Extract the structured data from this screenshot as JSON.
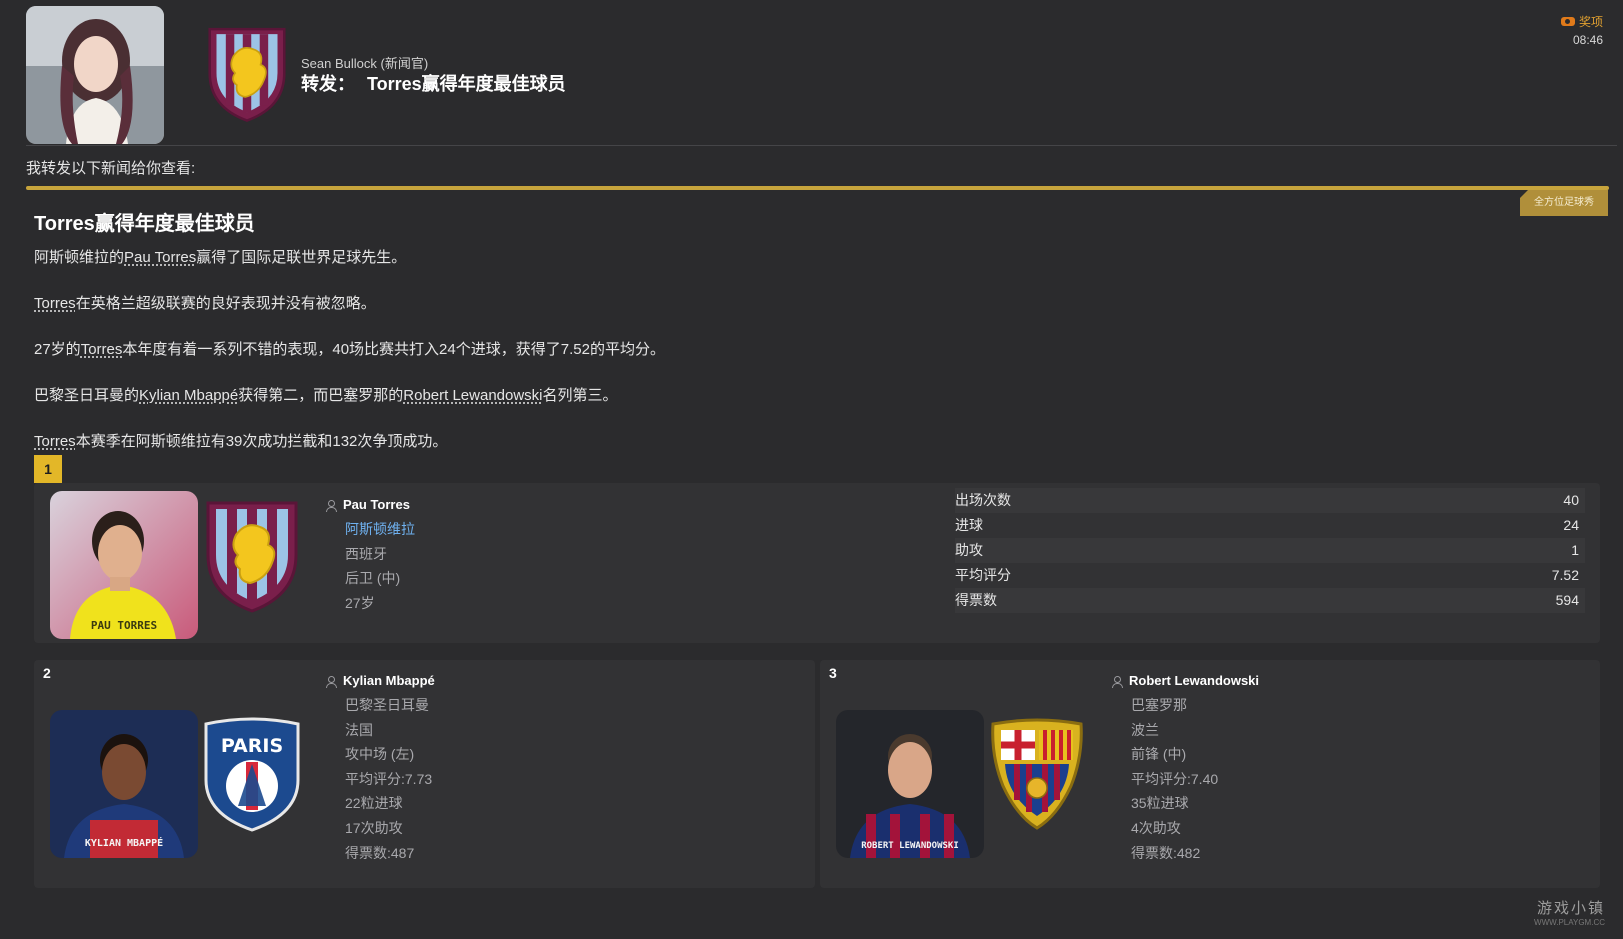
{
  "header": {
    "sender": "Sean Bullock (新闻官)",
    "subject_prefix": "转发：",
    "subject": "Torres赢得年度最佳球员",
    "award_label": "奖项",
    "time": "08:46"
  },
  "intro": "我转发以下新闻给你查看:",
  "article": {
    "tag": "全方位足球秀",
    "title": "Torres赢得年度最佳球员",
    "paragraphs": {
      "p1": {
        "a": "阿斯顿维拉的",
        "link": "Pau Torres",
        "b": "赢得了国际足联世界足球先生。"
      },
      "p2": {
        "link": "Torres",
        "b": "在英格兰超级联赛的良好表现并没有被忽略。"
      },
      "p3": {
        "a": "27岁的",
        "link": "Torres",
        "b": "本年度有着一系列不错的表现，40场比赛共打入24个进球，获得了7.52的平均分。"
      },
      "p4": {
        "a": "巴黎圣日耳曼的",
        "link": "Kylian Mbappé",
        "b": "获得第二，而巴塞罗那的",
        "link2": "Robert Lewandowski",
        "c": "名列第三。"
      },
      "p5": {
        "link": "Torres",
        "b": "本赛季在阿斯顿维拉有39次成功拦截和132次争顶成功。"
      }
    }
  },
  "winner": {
    "rank": "1",
    "name": "Pau Torres",
    "club": "阿斯顿维拉",
    "nation": "西班牙",
    "position": "后卫 (中)",
    "age": "27岁",
    "photo_caption": "PAU TORRES",
    "stats": [
      {
        "label": "出场次数",
        "value": "40"
      },
      {
        "label": "进球",
        "value": "24"
      },
      {
        "label": "助攻",
        "value": "1"
      },
      {
        "label": "平均评分",
        "value": "7.52"
      },
      {
        "label": "得票数",
        "value": "594"
      }
    ]
  },
  "runner_up": {
    "rank": "2",
    "name": "Kylian Mbappé",
    "club": "巴黎圣日耳曼",
    "nation": "法国",
    "position": "攻中场 (左)",
    "rating": "平均评分:7.73",
    "goals": "22粒进球",
    "assists": "17次助攻",
    "votes": "得票数:487",
    "photo_caption": "KYLIAN MBAPPÉ",
    "crest_text": "PARIS"
  },
  "third": {
    "rank": "3",
    "name": "Robert Lewandowski",
    "club": "巴塞罗那",
    "nation": "波兰",
    "position": "前锋 (中)",
    "rating": "平均评分:7.40",
    "goals": "35粒进球",
    "assists": "4次助攻",
    "votes": "得票数:482",
    "photo_caption": "ROBERT LEWANDOWSKI"
  },
  "watermark": {
    "main": "游戏小镇",
    "sub": "WWW.PLAYGM.CC"
  },
  "colors": {
    "background": "#2b2b2d",
    "accent_gold": "#c7a43c",
    "link_blue": "#6fb1f0",
    "rank_badge": "#e3b728"
  }
}
